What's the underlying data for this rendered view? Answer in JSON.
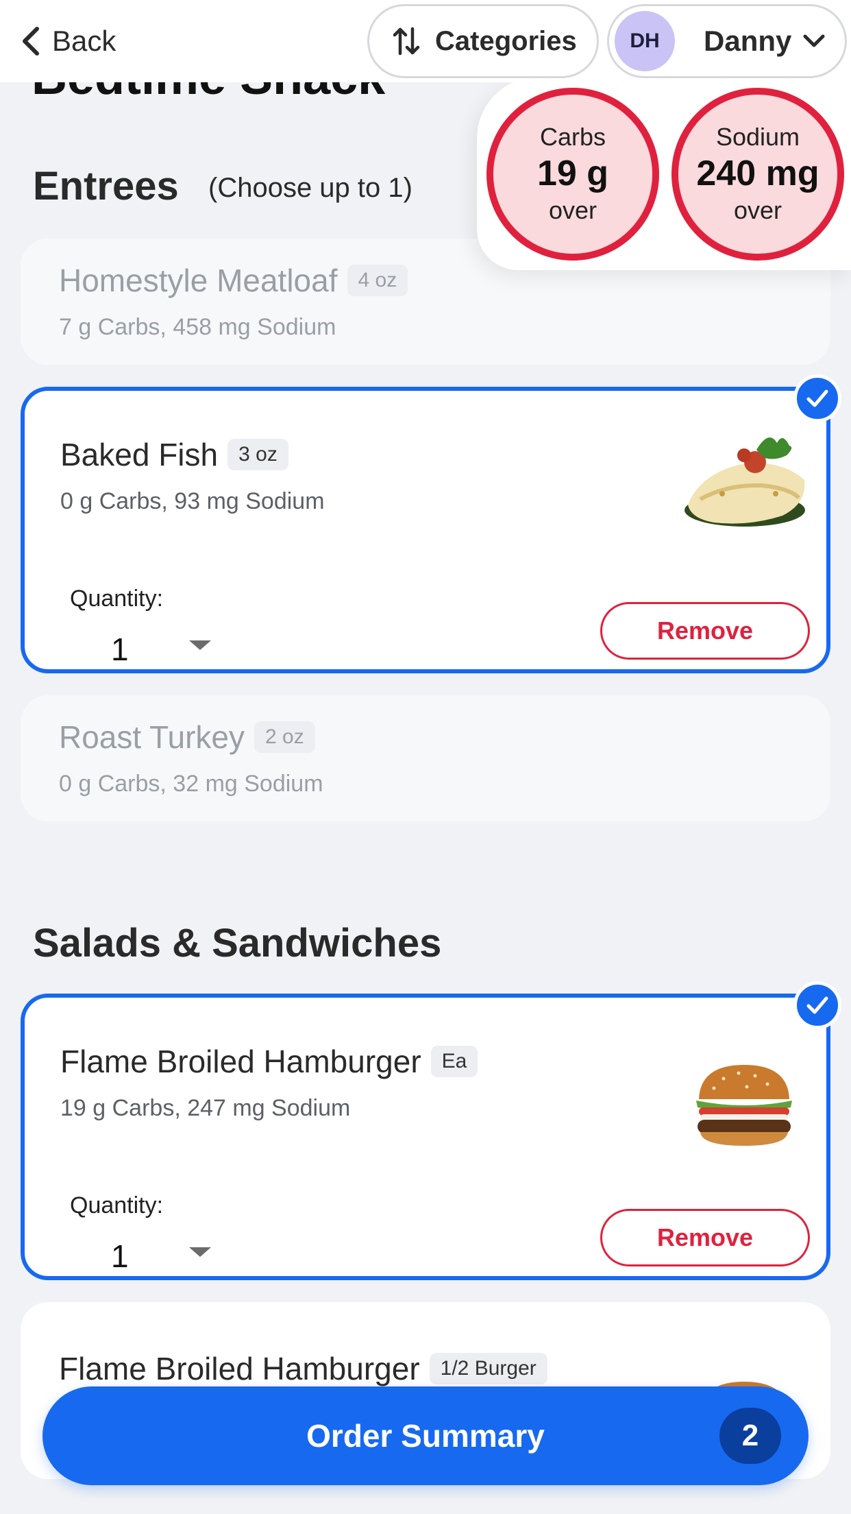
{
  "nav": {
    "back_label": "Back",
    "categories_label": "Categories",
    "user": {
      "initials": "DH",
      "name": "Danny"
    }
  },
  "page": {
    "title": "Bedtime Snack"
  },
  "nutrients": {
    "carbs": {
      "label": "Carbs",
      "value": "19 g",
      "status": "over"
    },
    "sodium": {
      "label": "Sodium",
      "value": "240 mg",
      "status": "over"
    }
  },
  "sections": [
    {
      "title": "Entrees",
      "hint": "(Choose up to 1)",
      "items": [
        {
          "name": "Homestyle Meatloaf",
          "portion": "4 oz",
          "nutrition": "7 g Carbs, 458 mg Sodium",
          "state": "disabled"
        },
        {
          "name": "Baked Fish",
          "portion": "3 oz",
          "nutrition": "0 g Carbs, 93 mg Sodium",
          "state": "selected",
          "quantity_label": "Quantity:",
          "quantity": "1",
          "remove_label": "Remove"
        },
        {
          "name": "Roast Turkey",
          "portion": "2 oz",
          "nutrition": "0 g Carbs, 32 mg Sodium",
          "state": "disabled"
        }
      ]
    },
    {
      "title": "Salads & Sandwiches",
      "items": [
        {
          "name": "Flame Broiled Hamburger",
          "portion": "Ea",
          "nutrition": "19 g Carbs, 247 mg Sodium",
          "state": "selected",
          "quantity_label": "Quantity:",
          "quantity": "1",
          "remove_label": "Remove"
        },
        {
          "name": "Flame Broiled Hamburger",
          "portion": "1/2 Burger",
          "state": "available"
        }
      ]
    }
  ],
  "order_summary": {
    "label": "Order Summary",
    "count": "2"
  },
  "colors": {
    "accent": "#1769f0",
    "danger": "#e0213e",
    "danger_bg": "#fadadd",
    "avatar_bg": "#c9c3f6"
  }
}
